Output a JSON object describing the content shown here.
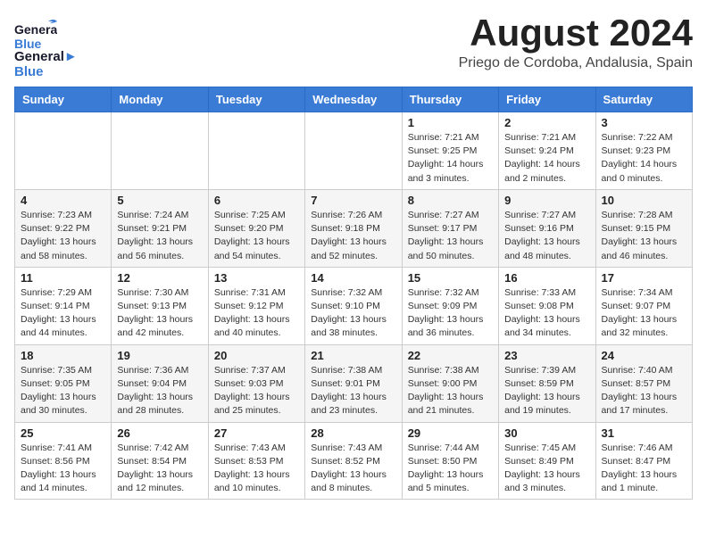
{
  "logo": {
    "line1": "General",
    "line2": "Blue"
  },
  "header": {
    "month_year": "August 2024",
    "location": "Priego de Cordoba, Andalusia, Spain"
  },
  "weekdays": [
    "Sunday",
    "Monday",
    "Tuesday",
    "Wednesday",
    "Thursday",
    "Friday",
    "Saturday"
  ],
  "weeks": [
    [
      {
        "day": "",
        "info": ""
      },
      {
        "day": "",
        "info": ""
      },
      {
        "day": "",
        "info": ""
      },
      {
        "day": "",
        "info": ""
      },
      {
        "day": "1",
        "info": "Sunrise: 7:21 AM\nSunset: 9:25 PM\nDaylight: 14 hours\nand 3 minutes."
      },
      {
        "day": "2",
        "info": "Sunrise: 7:21 AM\nSunset: 9:24 PM\nDaylight: 14 hours\nand 2 minutes."
      },
      {
        "day": "3",
        "info": "Sunrise: 7:22 AM\nSunset: 9:23 PM\nDaylight: 14 hours\nand 0 minutes."
      }
    ],
    [
      {
        "day": "4",
        "info": "Sunrise: 7:23 AM\nSunset: 9:22 PM\nDaylight: 13 hours\nand 58 minutes."
      },
      {
        "day": "5",
        "info": "Sunrise: 7:24 AM\nSunset: 9:21 PM\nDaylight: 13 hours\nand 56 minutes."
      },
      {
        "day": "6",
        "info": "Sunrise: 7:25 AM\nSunset: 9:20 PM\nDaylight: 13 hours\nand 54 minutes."
      },
      {
        "day": "7",
        "info": "Sunrise: 7:26 AM\nSunset: 9:18 PM\nDaylight: 13 hours\nand 52 minutes."
      },
      {
        "day": "8",
        "info": "Sunrise: 7:27 AM\nSunset: 9:17 PM\nDaylight: 13 hours\nand 50 minutes."
      },
      {
        "day": "9",
        "info": "Sunrise: 7:27 AM\nSunset: 9:16 PM\nDaylight: 13 hours\nand 48 minutes."
      },
      {
        "day": "10",
        "info": "Sunrise: 7:28 AM\nSunset: 9:15 PM\nDaylight: 13 hours\nand 46 minutes."
      }
    ],
    [
      {
        "day": "11",
        "info": "Sunrise: 7:29 AM\nSunset: 9:14 PM\nDaylight: 13 hours\nand 44 minutes."
      },
      {
        "day": "12",
        "info": "Sunrise: 7:30 AM\nSunset: 9:13 PM\nDaylight: 13 hours\nand 42 minutes."
      },
      {
        "day": "13",
        "info": "Sunrise: 7:31 AM\nSunset: 9:12 PM\nDaylight: 13 hours\nand 40 minutes."
      },
      {
        "day": "14",
        "info": "Sunrise: 7:32 AM\nSunset: 9:10 PM\nDaylight: 13 hours\nand 38 minutes."
      },
      {
        "day": "15",
        "info": "Sunrise: 7:32 AM\nSunset: 9:09 PM\nDaylight: 13 hours\nand 36 minutes."
      },
      {
        "day": "16",
        "info": "Sunrise: 7:33 AM\nSunset: 9:08 PM\nDaylight: 13 hours\nand 34 minutes."
      },
      {
        "day": "17",
        "info": "Sunrise: 7:34 AM\nSunset: 9:07 PM\nDaylight: 13 hours\nand 32 minutes."
      }
    ],
    [
      {
        "day": "18",
        "info": "Sunrise: 7:35 AM\nSunset: 9:05 PM\nDaylight: 13 hours\nand 30 minutes."
      },
      {
        "day": "19",
        "info": "Sunrise: 7:36 AM\nSunset: 9:04 PM\nDaylight: 13 hours\nand 28 minutes."
      },
      {
        "day": "20",
        "info": "Sunrise: 7:37 AM\nSunset: 9:03 PM\nDaylight: 13 hours\nand 25 minutes."
      },
      {
        "day": "21",
        "info": "Sunrise: 7:38 AM\nSunset: 9:01 PM\nDaylight: 13 hours\nand 23 minutes."
      },
      {
        "day": "22",
        "info": "Sunrise: 7:38 AM\nSunset: 9:00 PM\nDaylight: 13 hours\nand 21 minutes."
      },
      {
        "day": "23",
        "info": "Sunrise: 7:39 AM\nSunset: 8:59 PM\nDaylight: 13 hours\nand 19 minutes."
      },
      {
        "day": "24",
        "info": "Sunrise: 7:40 AM\nSunset: 8:57 PM\nDaylight: 13 hours\nand 17 minutes."
      }
    ],
    [
      {
        "day": "25",
        "info": "Sunrise: 7:41 AM\nSunset: 8:56 PM\nDaylight: 13 hours\nand 14 minutes."
      },
      {
        "day": "26",
        "info": "Sunrise: 7:42 AM\nSunset: 8:54 PM\nDaylight: 13 hours\nand 12 minutes."
      },
      {
        "day": "27",
        "info": "Sunrise: 7:43 AM\nSunset: 8:53 PM\nDaylight: 13 hours\nand 10 minutes."
      },
      {
        "day": "28",
        "info": "Sunrise: 7:43 AM\nSunset: 8:52 PM\nDaylight: 13 hours\nand 8 minutes."
      },
      {
        "day": "29",
        "info": "Sunrise: 7:44 AM\nSunset: 8:50 PM\nDaylight: 13 hours\nand 5 minutes."
      },
      {
        "day": "30",
        "info": "Sunrise: 7:45 AM\nSunset: 8:49 PM\nDaylight: 13 hours\nand 3 minutes."
      },
      {
        "day": "31",
        "info": "Sunrise: 7:46 AM\nSunset: 8:47 PM\nDaylight: 13 hours\nand 1 minute."
      }
    ]
  ]
}
